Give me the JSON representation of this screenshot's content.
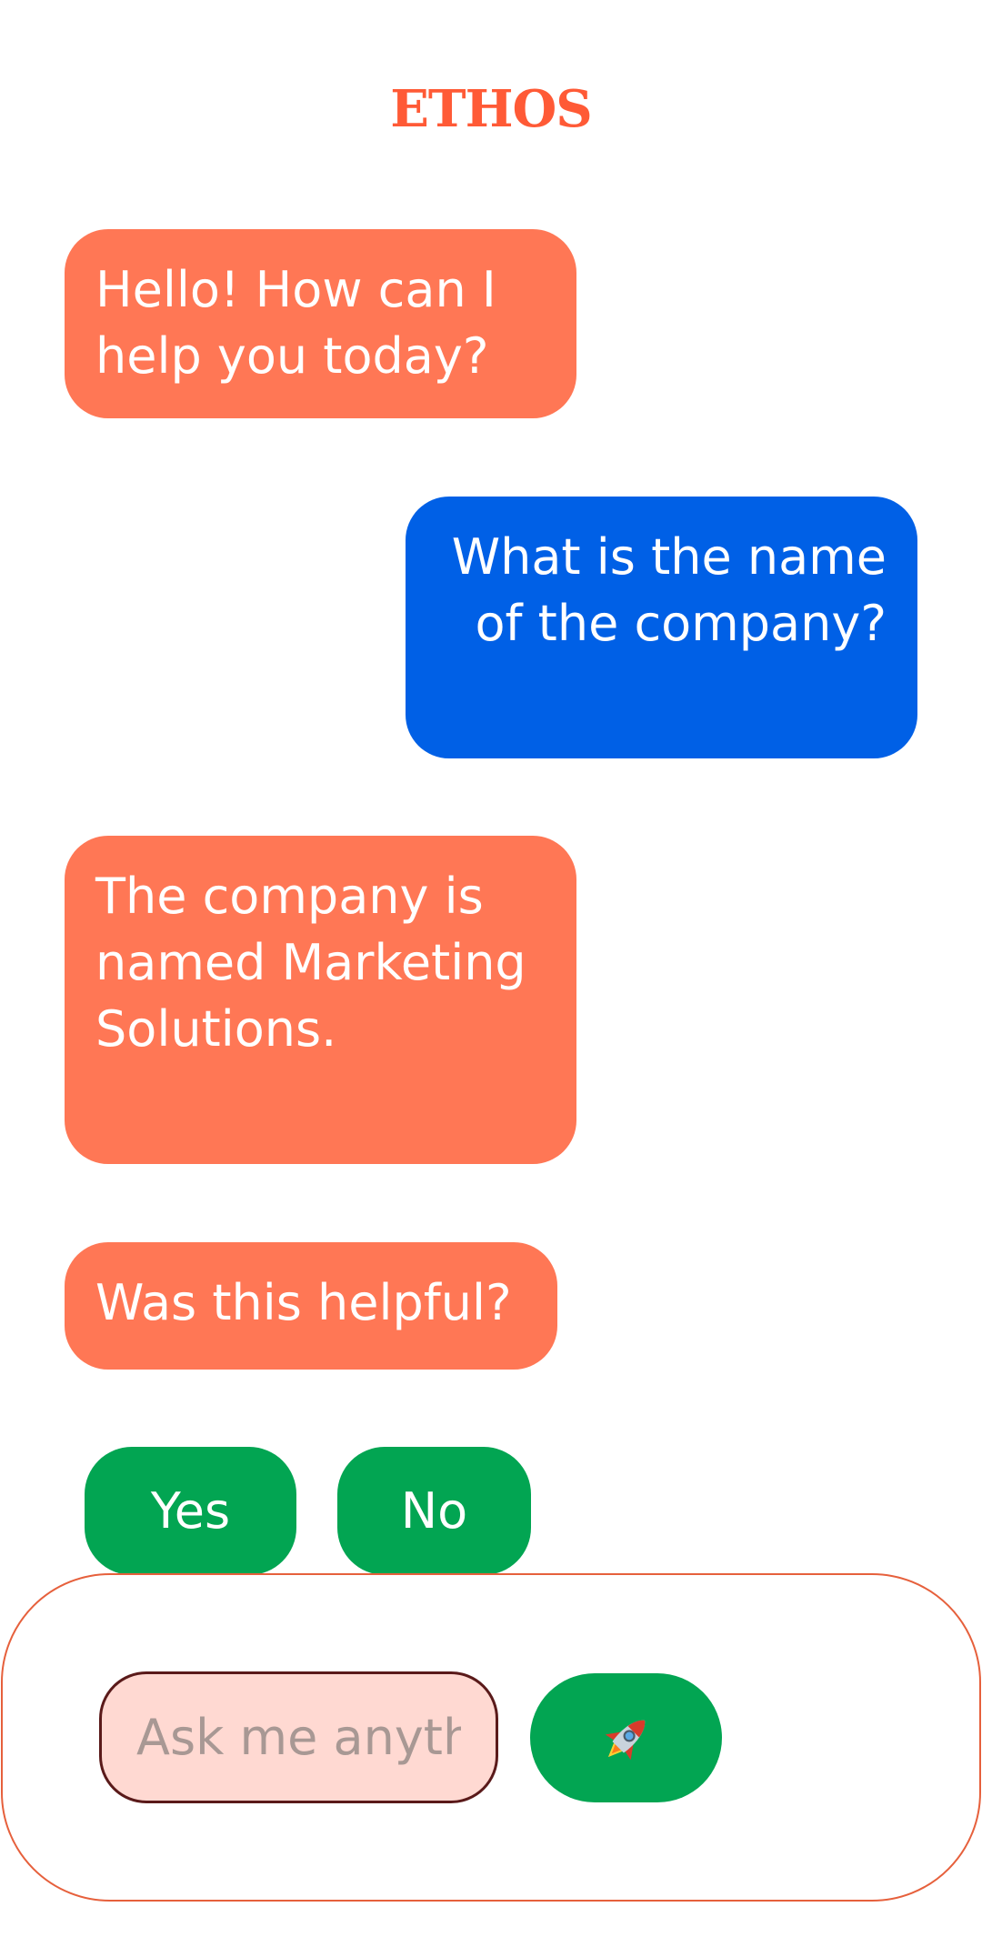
{
  "header": {
    "logo": "ETHOS"
  },
  "messages": [
    {
      "role": "bot",
      "text": "Hello! How can I help you today?"
    },
    {
      "role": "user",
      "text": "What is the name of the company?"
    },
    {
      "role": "bot",
      "text": "The company is named Marketing Solutions."
    },
    {
      "role": "bot",
      "text": "Was this helpful?"
    }
  ],
  "feedback": {
    "yes_label": "Yes",
    "no_label": "No"
  },
  "composer": {
    "placeholder": "Ask me anything",
    "value": "",
    "send_icon": "rocket-icon"
  },
  "colors": {
    "brand": "#ff5a36",
    "bot_bubble": "#ff7755",
    "user_bubble": "#0060e6",
    "action_green": "#02a552",
    "input_bg": "#ffd9d2"
  }
}
